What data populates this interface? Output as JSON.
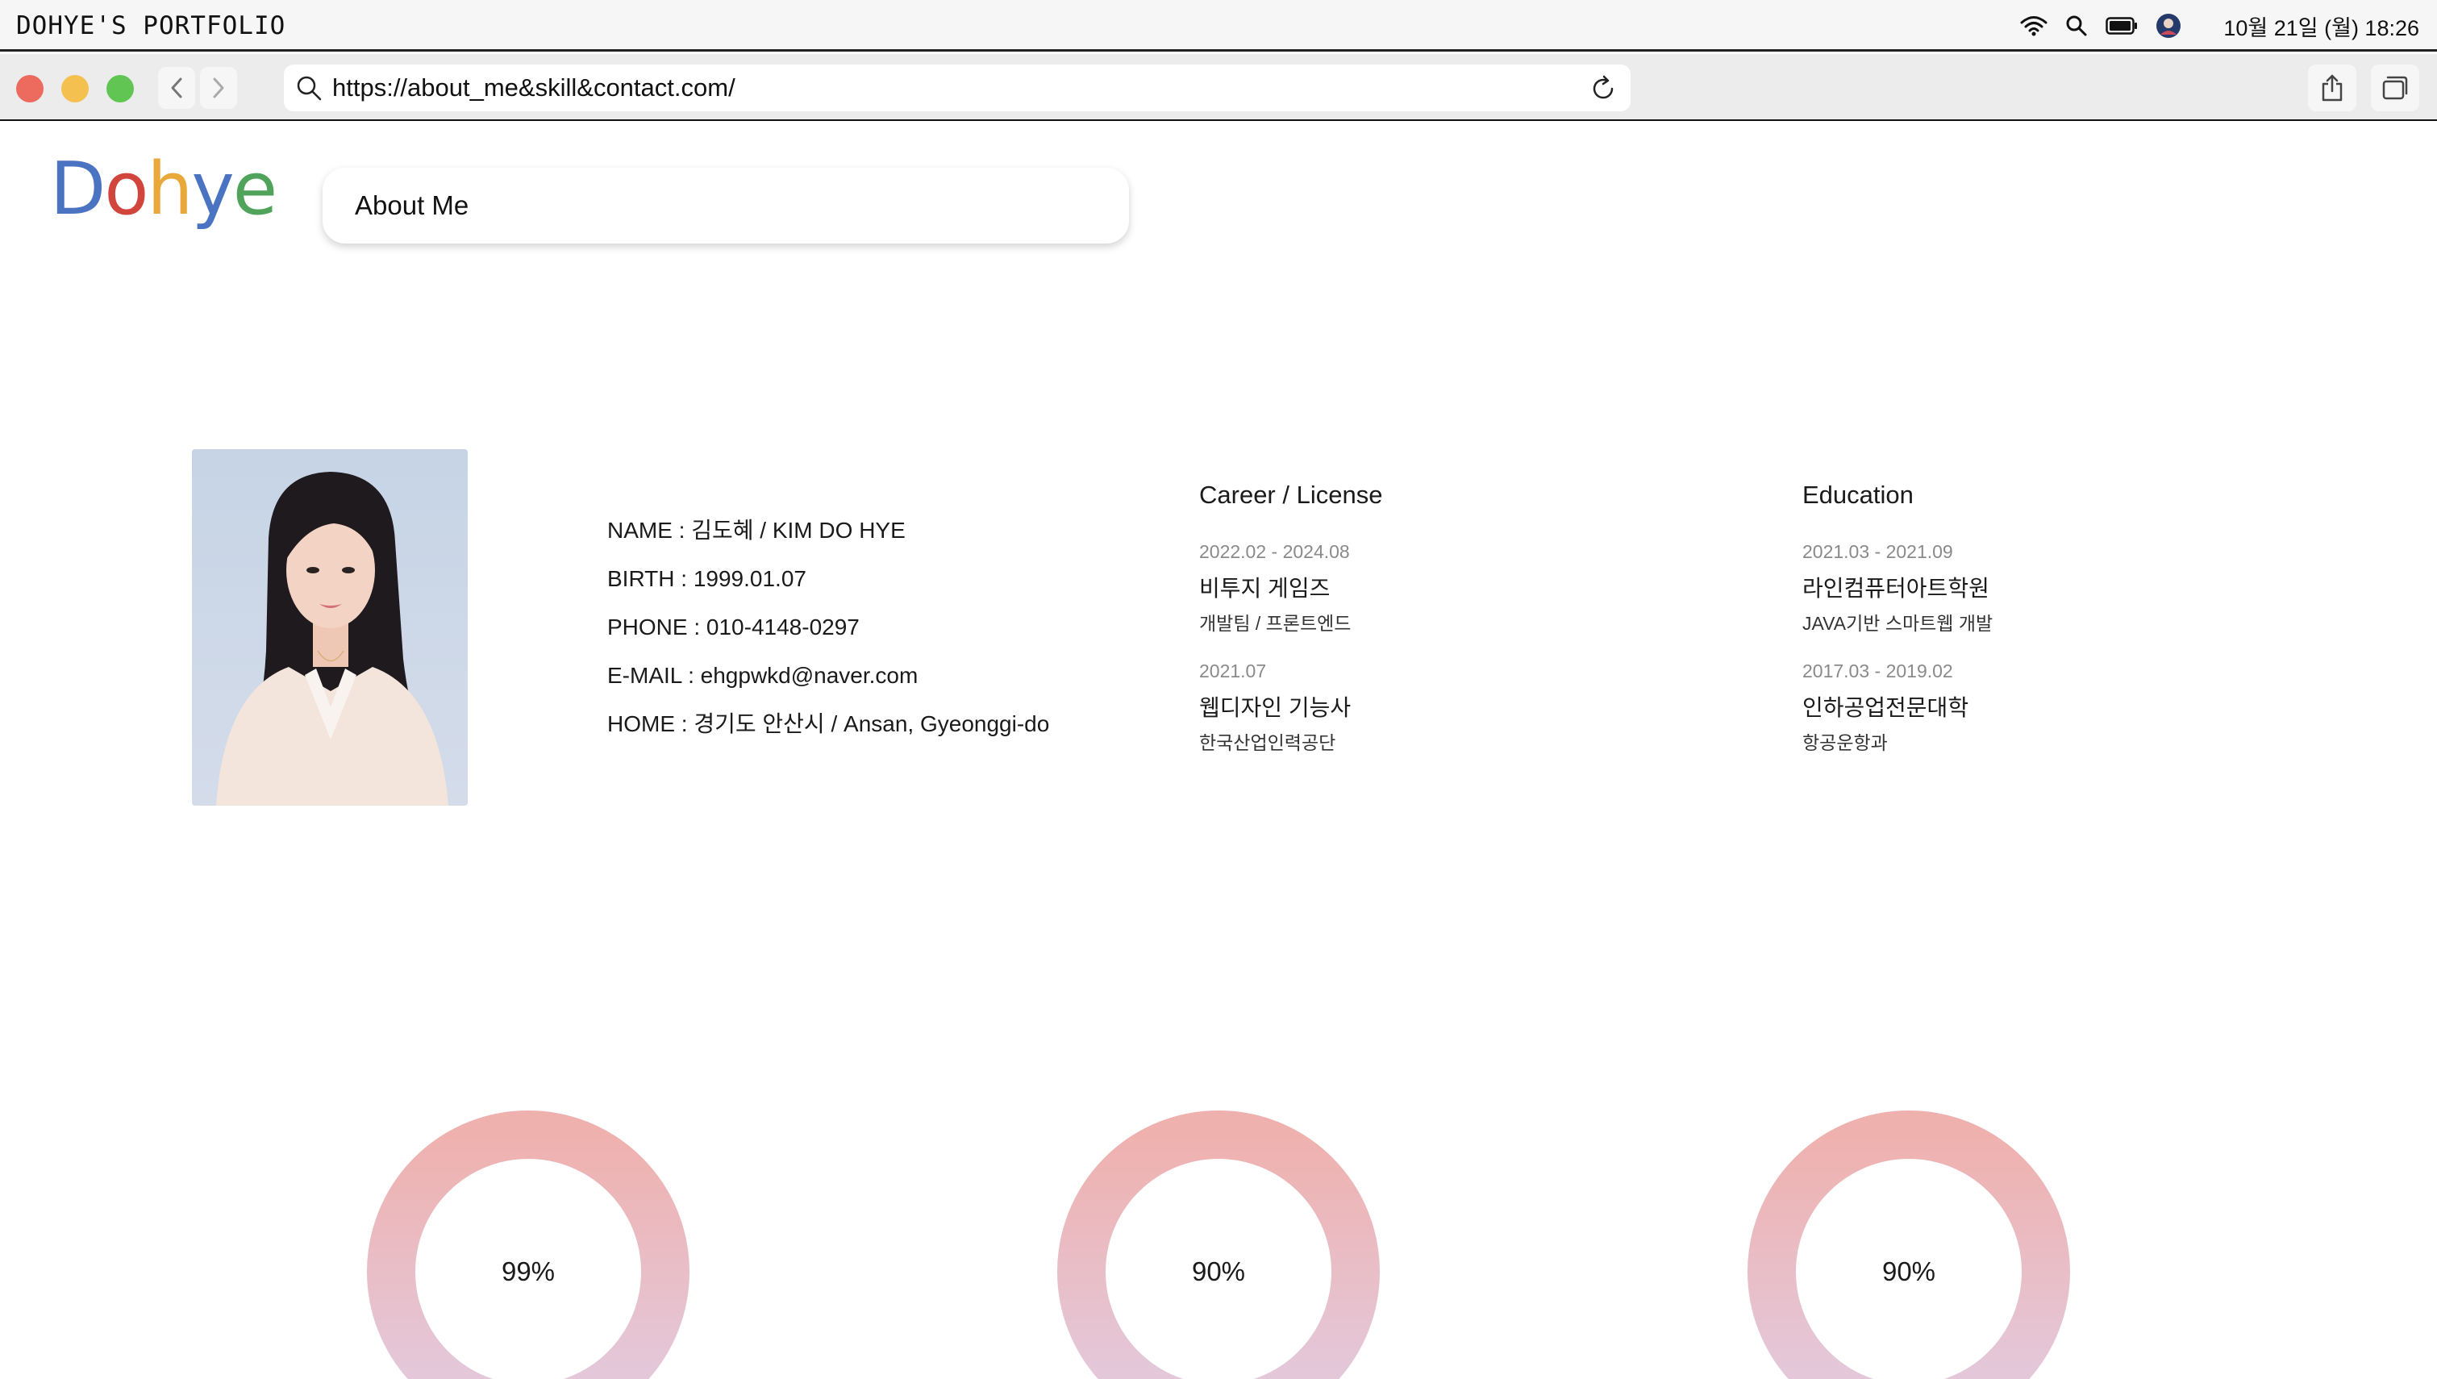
{
  "menubar": {
    "app_title": "DOHYE'S PORTFOLIO",
    "clock": "10월 21일 (월) 18:26",
    "icons": [
      "wifi-icon",
      "search-icon",
      "battery-icon",
      "user-avatar-icon"
    ]
  },
  "browser": {
    "url": "https://about_me&skill&contact.com/",
    "buttons": [
      "back-icon",
      "forward-icon",
      "reload-icon",
      "share-icon",
      "tabs-icon"
    ]
  },
  "logo": {
    "letters": [
      "D",
      "o",
      "h",
      "y",
      "e"
    ],
    "colors": [
      "#4a73c2",
      "#d2453c",
      "#e8a93a",
      "#4a73c2",
      "#4fa35a"
    ]
  },
  "nav": {
    "label": "About Me"
  },
  "profile": {
    "name": "NAME : 김도혜 / KIM DO HYE",
    "birth": "BIRTH : 1999.01.07",
    "phone": "PHONE : 010-4148-0297",
    "email": "E-MAIL : ehgpwkd@naver.com",
    "home": "HOME : 경기도 안산시 / Ansan, Gyeonggi-do"
  },
  "career": {
    "title": "Career / License",
    "items": [
      {
        "date": "2022.02 - 2024.08",
        "name": "비투지 게임즈",
        "sub": "개발팀 / 프론트엔드"
      },
      {
        "date": "2021.07",
        "name": "웹디자인 기능사",
        "sub": "한국산업인력공단"
      }
    ]
  },
  "education": {
    "title": "Education",
    "items": [
      {
        "date": "2021.03 - 2021.09",
        "name": "라인컴퓨터아트학원",
        "sub": "JAVA기반 스마트웹 개발"
      },
      {
        "date": "2017.03 - 2019.02",
        "name": "인하공업전문대학",
        "sub": "항공운항과"
      }
    ]
  },
  "skills": {
    "gradient": [
      "#efb1ae",
      "#e2cbe0"
    ],
    "items": [
      {
        "value": "99%"
      },
      {
        "value": "90%"
      },
      {
        "value": "90%"
      }
    ]
  }
}
